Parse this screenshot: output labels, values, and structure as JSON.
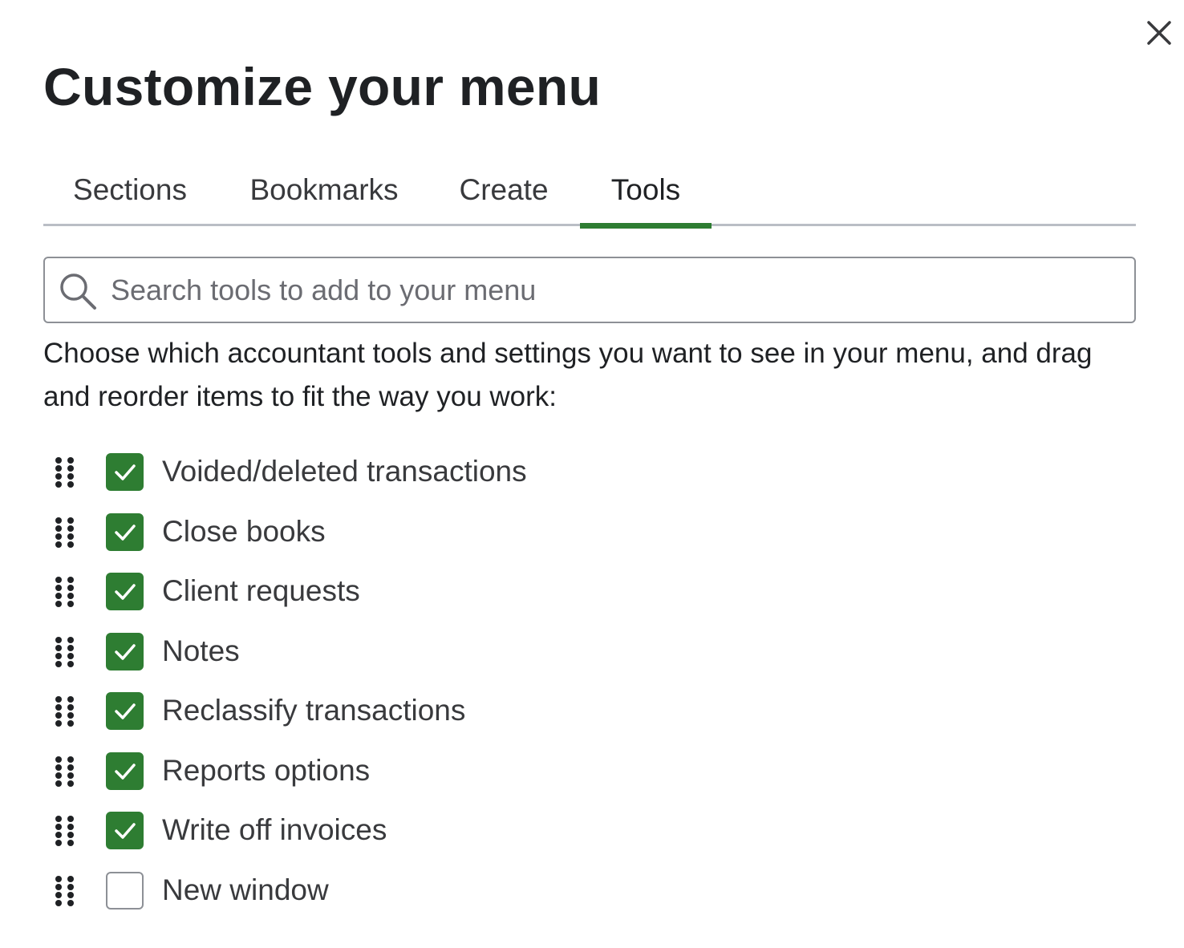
{
  "dialog": {
    "title": "Customize your menu",
    "close_icon": "close-icon"
  },
  "tabs": [
    {
      "label": "Sections",
      "active": false
    },
    {
      "label": "Bookmarks",
      "active": false
    },
    {
      "label": "Create",
      "active": false
    },
    {
      "label": "Tools",
      "active": true
    }
  ],
  "search": {
    "placeholder": "Search tools to add to your menu",
    "value": "",
    "icon": "search-icon"
  },
  "description": "Choose which accountant tools and settings you want to see in your menu, and drag and reorder items to fit the way you work:",
  "items": [
    {
      "label": "Voided/deleted transactions",
      "checked": true
    },
    {
      "label": "Close books",
      "checked": true
    },
    {
      "label": "Client requests",
      "checked": true
    },
    {
      "label": "Notes",
      "checked": true
    },
    {
      "label": "Reclassify transactions",
      "checked": true
    },
    {
      "label": "Reports options",
      "checked": true
    },
    {
      "label": "Write off invoices",
      "checked": true
    },
    {
      "label": "New window",
      "checked": false
    }
  ],
  "colors": {
    "accent": "#2e7d32",
    "text": "#393a3d",
    "title": "#1f2124",
    "border": "#8d9096",
    "tab_underline": "#babec5"
  }
}
